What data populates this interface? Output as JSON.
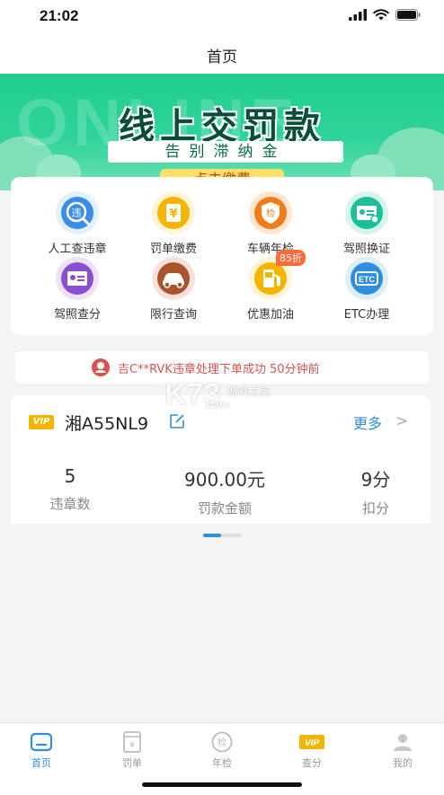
{
  "status_bar": {
    "time": "21:02"
  },
  "nav": {
    "title": "首页"
  },
  "banner": {
    "watermark": "ONLINE",
    "title": "线上交罚款",
    "subtitle": "告别滞纳金",
    "button": "点击缴费"
  },
  "services": [
    {
      "label": "人工查违章",
      "icon": "violation-query-icon",
      "color": "#3a8ee6"
    },
    {
      "label": "罚单缴费",
      "icon": "ticket-payment-icon",
      "color": "#f5b400"
    },
    {
      "label": "车辆年检",
      "icon": "annual-inspection-icon",
      "color": "#f07c1a"
    },
    {
      "label": "驾照换证",
      "icon": "license-renewal-icon",
      "color": "#1dbf9a"
    },
    {
      "label": "驾照查分",
      "icon": "license-points-icon",
      "color": "#8a4fd1"
    },
    {
      "label": "限行查询",
      "icon": "traffic-restriction-icon",
      "color": "#a9542f"
    },
    {
      "label": "优惠加油",
      "icon": "fuel-discount-icon",
      "color": "#f5b400",
      "badge": "85折"
    },
    {
      "label": "ETC办理",
      "icon": "etc-icon",
      "color": "#2e8ee0",
      "icon_text": "ETC"
    }
  ],
  "icon_glyphs": {
    "violation": "违",
    "ticket": "¥",
    "inspection": "检"
  },
  "notice": {
    "text": "吉C**RVK违章处理下单成功 50分钟前"
  },
  "watermark": {
    "main": "K73",
    "sub": "游戏之家",
    "url": ".com"
  },
  "vehicle": {
    "vip_tag": "VIP",
    "plate": "湘A55NL9",
    "more_label": "更多",
    "more_chevron": ">",
    "stats": [
      {
        "value": "5",
        "label": "违章数"
      },
      {
        "value": "900.00元",
        "label": "罚款金额"
      },
      {
        "value": "9分",
        "label": "扣分"
      }
    ]
  },
  "tabs": [
    {
      "label": "首页",
      "icon": "home-icon",
      "active": true
    },
    {
      "label": "罚单",
      "icon": "ticket-icon",
      "active": false
    },
    {
      "label": "年检",
      "icon": "inspection-icon",
      "active": false
    },
    {
      "label": "查分",
      "icon": "vip-icon",
      "active": false,
      "icon_text": "VIP"
    },
    {
      "label": "我的",
      "icon": "profile-icon",
      "active": false
    }
  ],
  "colors": {
    "accent": "#2e8ee0",
    "banner_green": "#1fcf8c",
    "notice_red": "#d9534f"
  }
}
